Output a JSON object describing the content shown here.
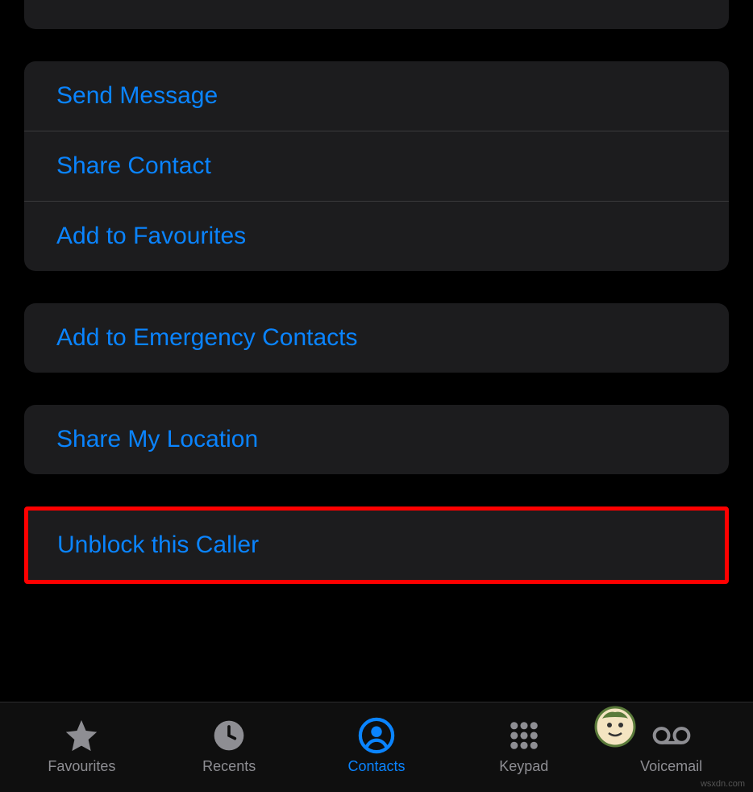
{
  "actions": {
    "group1": {
      "send_message": "Send Message",
      "share_contact": "Share Contact",
      "add_favourites": "Add to Favourites"
    },
    "group2": {
      "emergency": "Add to Emergency Contacts"
    },
    "group3": {
      "share_location": "Share My Location"
    },
    "group4": {
      "unblock": "Unblock this Caller"
    }
  },
  "tabs": {
    "favourites": "Favourites",
    "recents": "Recents",
    "contacts": "Contacts",
    "keypad": "Keypad",
    "voicemail": "Voicemail"
  },
  "colors": {
    "link": "#0a84ff",
    "inactive": "#8e8e93",
    "card": "#1c1c1e",
    "highlight": "#ff0000"
  },
  "watermark": "wsxdn.com"
}
